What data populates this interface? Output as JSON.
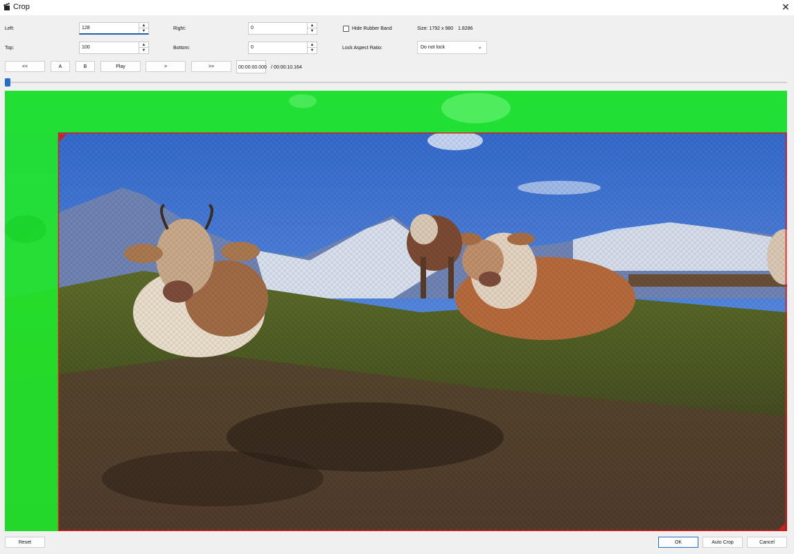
{
  "window": {
    "title": "Crop",
    "close_icon": "close-icon",
    "app_icon": "clapperboard-icon"
  },
  "crop": {
    "left_label": "Left:",
    "left_value": "128",
    "top_label": "Top:",
    "top_value": "100",
    "right_label": "Right:",
    "right_value": "0",
    "bottom_label": "Bottom:",
    "bottom_value": "0"
  },
  "options": {
    "hide_rubber_band_label": "Hide Rubber Band",
    "hide_rubber_band_checked": false,
    "size_text": "Size: 1792 x 980",
    "ratio_text": "1.8286",
    "lock_aspect_label": "Lock Aspect Ratio:",
    "lock_aspect_value": "Do not lock"
  },
  "transport": {
    "first_label": "<<",
    "a_label": "A",
    "b_label": "B",
    "play_label": "Play",
    "next_label": ">",
    "last_label": ">>",
    "current_time": "00:00:00.000",
    "total_time": "/ 00:00:10.164"
  },
  "timeline": {
    "position_fraction": 0.0
  },
  "footer": {
    "reset_label": "Reset",
    "ok_label": "OK",
    "auto_crop_label": "Auto Crop",
    "cancel_label": "Cancel"
  },
  "colors": {
    "crop_overlay": "#21e62b",
    "crop_border": "#e01a1a",
    "accent": "#1e6fd0"
  }
}
